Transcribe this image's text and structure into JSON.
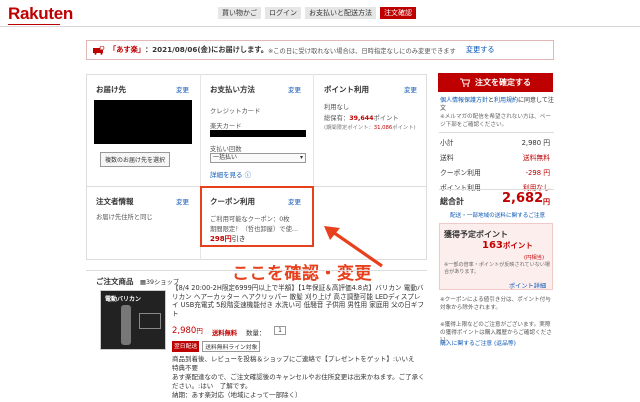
{
  "header": {
    "logo": "Rakuten",
    "steps": [
      "買い物かご",
      "ログイン",
      "お支払いと配送方法",
      "注文確認"
    ]
  },
  "notice": {
    "brand": "「あす楽」",
    "date_text": "：2021/08/06(金)にお届けします。",
    "note": "※この日に受け取れない場合は、日時指定なしにのみ変更できます",
    "link": "変更する"
  },
  "delivery": {
    "title": "お届け先",
    "change": "変更",
    "multi_btn": "複数のお届け先を選択"
  },
  "payment": {
    "title": "お支払い方法",
    "change": "変更",
    "method": "クレジットカード",
    "card_label": "楽天カード",
    "installment_label": "支払い回数",
    "installment_value": "一括払い",
    "details_link": "詳細を見る"
  },
  "points": {
    "title": "ポイント利用",
    "change": "変更",
    "status": "利用なし",
    "holding_label": "総保有：",
    "holding_value": "39,644",
    "holding_unit": "ポイント",
    "limited_label": "(期間限定ポイント：",
    "limited_value": "31,086",
    "limited_unit": "ポイント)"
  },
  "orderer": {
    "title": "注文者情報",
    "change": "変更",
    "same": "お届け先住所と同じ"
  },
  "coupon": {
    "title": "クーポン利用",
    "change": "変更",
    "line1": "ご利用可能なクーポン：",
    "line1_count": "0枚",
    "line2": "期間限定！（哲也卸屋）で使…",
    "discount": "298円",
    "discount_suffix": "引き"
  },
  "annotation": "ここを確認・変更",
  "product_section": {
    "title": "ご注文商品",
    "shop_count": "39ショップ",
    "description": "【8/4 20:00-2H限定6999円以上で半額】【1年保証＆高評価4.8点】バリカン 電動バリカン ヘアーカッター ヘアクリッパー 散髪 刈り上げ 高さ調整可能 LEDディスプレイ USB充電式 5段階変速機能付き 水洗い可 低騒音 子供用 男性用 家庭用 父の日ギフト",
    "price": "2,980",
    "price_unit": "円",
    "shipping_free": "送料無料",
    "qty_label": "数量：",
    "qty_value": "1",
    "badge_asuraku": "翌日配送",
    "badge_other": "送料無料ライン対象",
    "msg1": "商品到着後、レビューを投稿＆ショップにご連絡で【プレゼントをゲット】:いいえ　特典不要",
    "msg2": "あす楽配達なので、ご注文確認後のキャンセルやお住所変更は出来かねます。ご了承ください。:はい　了解です。",
    "msg3": "納期：あす楽対応（地域によって一部除く）",
    "image_text": "電動バリカン"
  },
  "summary": {
    "confirm_label": "注文を確定する",
    "agreement1": "個人情報保護方針",
    "agreement2": "と",
    "agreement3": "利用規約",
    "agreement4": "に同意して注文",
    "mailnote": "※メルマガの配信を希望されない方は、ページ下部をご確認ください。",
    "rows": [
      {
        "label": "小計",
        "value": "2,980 円",
        "red": false
      },
      {
        "label": "送料",
        "value": "送料無料",
        "red": true
      },
      {
        "label": "クーポン利用",
        "value": "-298 円",
        "red": true
      },
      {
        "label": "ポイント利用",
        "value": "利用なし",
        "red": true
      }
    ],
    "total_label": "総合計",
    "total_value": "2,682",
    "total_unit": "円",
    "region_link": "配送・一部地域の送料に関するご注意",
    "point_title": "獲得予定ポイント",
    "point_value": "163",
    "point_unit": "ポイント",
    "point_sub": "(円相当)",
    "point_note": "※一部の倍率・ポイントが反映されていない場合があります。",
    "point_link": "ポイント詳細",
    "coupon_note": "※クーポンによる値引き分は、ポイント付与対象から除外されます。",
    "terms_note": "※獲得上限などのご注意がございます。実際の獲得ポイントは購入履歴からご確認ください。",
    "terms_link": "購入に関するご注意 (返品等)"
  },
  "colors": {
    "brand_red": "#bf0000",
    "annotation_orange": "#e8401c",
    "link_blue": "#0b57b5"
  }
}
